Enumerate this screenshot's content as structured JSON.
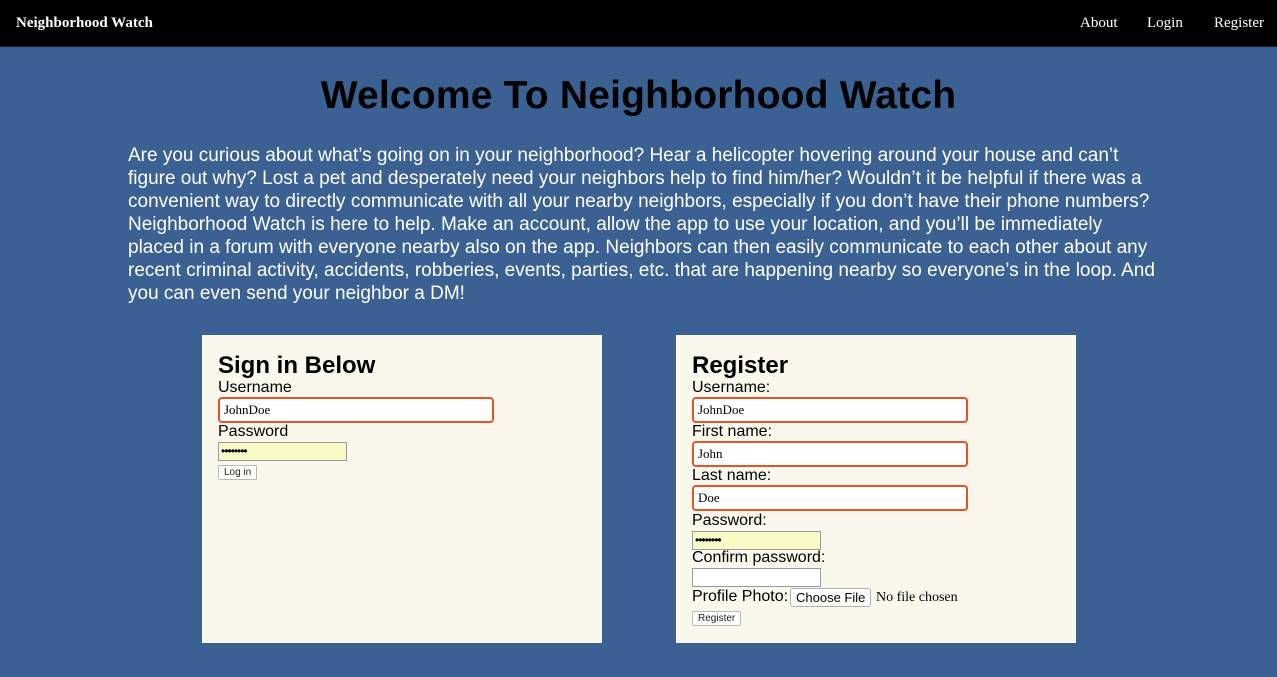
{
  "navbar": {
    "brand": "Neighborhood Watch",
    "links": [
      "About",
      "Login",
      "Register"
    ]
  },
  "main": {
    "title": "Welcome To Neighborhood Watch",
    "intro": "Are you curious about what’s going on in your neighborhood? Hear a helicopter hovering around your house and can’t figure out why? Lost a pet and desperately need your neighbors help to find him/her? Wouldn’t it be helpful if there was a convenient way to directly communicate with all your nearby neighbors, especially if you don’t have their phone numbers? Neighborhood Watch is here to help. Make an account, allow the app to use your location, and you’ll be immediately placed in a forum with everyone nearby also on the app. Neighbors can then easily communicate to each other about any recent criminal activity, accidents, robberies, events, parties, etc. that are happening nearby so everyone’s in the loop. And you can even send your neighbor a DM!"
  },
  "login": {
    "title": "Sign in Below",
    "username_label": "Username",
    "username_value": "JohnDoe",
    "password_label": "Password",
    "password_mask": "••••••••",
    "button": "Log in"
  },
  "register": {
    "title": "Register",
    "username_label": "Username:",
    "username_value": "JohnDoe",
    "first_name_label": "First name:",
    "first_name_value": "John",
    "last_name_label": "Last name:",
    "last_name_value": "Doe",
    "password_label": "Password:",
    "password_mask": "••••••••",
    "confirm_label": "Confirm password:",
    "photo_label": "Profile Photo:",
    "file_button": "Choose File",
    "file_status": "No file chosen",
    "button": "Register"
  },
  "colors": {
    "background": "#3a6191",
    "navbar": "#000000",
    "card": "#f8f8ec",
    "input_border": "#e2542a",
    "autofill": "#fafac6"
  }
}
